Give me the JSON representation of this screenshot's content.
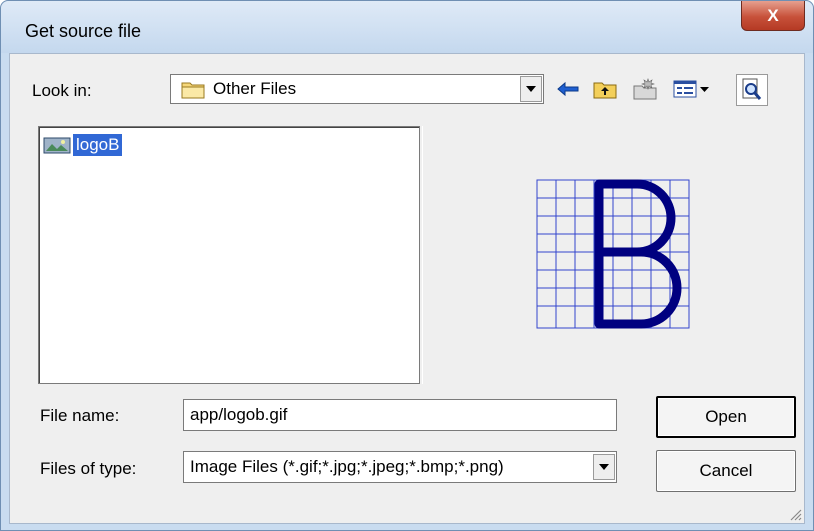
{
  "window": {
    "title": "Get source file",
    "close_label": "X"
  },
  "look_in": {
    "label": "Look in:",
    "value": "Other Files"
  },
  "toolbar": [
    "back-icon",
    "up-folder-icon",
    "new-folder-icon",
    "view-menu-icon",
    "preview-toggle-icon"
  ],
  "files": [
    {
      "name": "logoB",
      "icon": "image-file-icon",
      "selected": true
    }
  ],
  "preview": {
    "letter": "B"
  },
  "file_name": {
    "label": "File name:",
    "value": "app/logob.gif"
  },
  "file_type": {
    "label": "Files of type:",
    "value": "Image Files (*.gif;*.jpg;*.jpeg;*.bmp;*.png)"
  },
  "buttons": {
    "open": "Open",
    "cancel": "Cancel"
  },
  "colors": {
    "selection": "#3168d5",
    "preview_stroke": "#000080",
    "preview_grid": "#3344cc"
  }
}
